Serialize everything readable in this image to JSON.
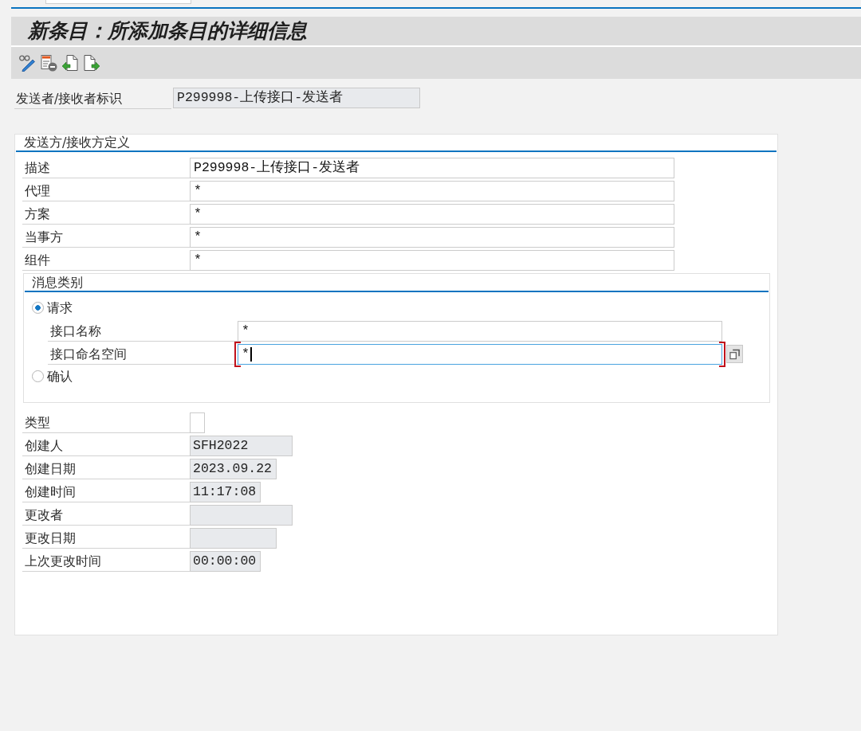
{
  "title": "新条目：所添加条目的详细信息",
  "identifier": {
    "label": "发送者/接收者标识",
    "value": "P299998-上传接口-发送者"
  },
  "definition": {
    "title": "发送方/接收方定义",
    "fields": [
      {
        "label": "描述",
        "value": "P299998-上传接口-发送者"
      },
      {
        "label": "代理",
        "value": "*"
      },
      {
        "label": "方案",
        "value": "*"
      },
      {
        "label": "当事方",
        "value": "*"
      },
      {
        "label": "组件",
        "value": "*"
      }
    ]
  },
  "message_category": {
    "title": "消息类别",
    "options": [
      {
        "label": "请求",
        "selected": true,
        "fields": [
          {
            "label": "接口名称",
            "value": "*",
            "focused": false
          },
          {
            "label": "接口命名空间",
            "value": "*",
            "focused": true
          }
        ]
      },
      {
        "label": "确认",
        "selected": false
      }
    ]
  },
  "admin_fields": [
    {
      "label": "类型",
      "kind": "flag"
    },
    {
      "label": "创建人",
      "kind": "user",
      "value": "SFH2022"
    },
    {
      "label": "创建日期",
      "kind": "date",
      "value": "2023.09.22"
    },
    {
      "label": "创建时间",
      "kind": "time",
      "value": "11:17:08"
    },
    {
      "label": "更改者",
      "kind": "user"
    },
    {
      "label": "更改日期",
      "kind": "date"
    },
    {
      "label": "上次更改时间",
      "kind": "time",
      "value": "00:00:00"
    }
  ]
}
